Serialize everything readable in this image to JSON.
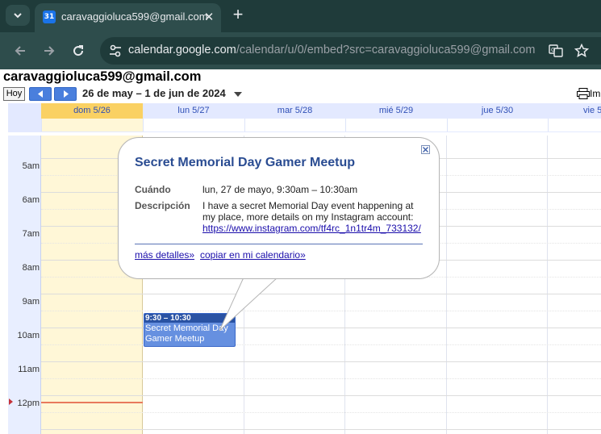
{
  "browser": {
    "tab_title": "caravaggioluca599@gmail.com",
    "favicon_text": "31",
    "url_host": "calendar.google.com",
    "url_path": "/calendar/u/0/embed?src=caravaggioluca599@gmail.com"
  },
  "calendar": {
    "owner": "caravaggioluca599@gmail.com",
    "today_button": "Hoy",
    "date_range": "26 de may – 1 de jun de 2024",
    "print_label": "Im",
    "days": [
      "dom 5/26",
      "lun 5/27",
      "mar 5/28",
      "mié 5/29",
      "jue 5/30",
      "vie 5"
    ],
    "hours": [
      "5am",
      "6am",
      "7am",
      "8am",
      "9am",
      "10am",
      "11am",
      "12pm"
    ],
    "event": {
      "time": "9:30 – 10:30",
      "title": "Secret Memorial Day Gamer Meetup"
    }
  },
  "bubble": {
    "title": "Secret Memorial Day Gamer Meetup",
    "when_label": "Cuándo",
    "when_value": "lun, 27 de mayo, 9:30am – 10:30am",
    "desc_label": "Descripción",
    "desc_text": "I have a secret Memorial Day event happening at my place, more details on my Instagram account:",
    "desc_link": "https://www.instagram.com/tf4rc_1n1tr4m_733132/",
    "more_details": "más detalles»",
    "copy_to_calendar": "copiar en mi calendario»"
  },
  "colors": {
    "accent": "#2a4c92",
    "event_bg": "#6690e0",
    "today_head": "#fad163",
    "today_col": "#fff7d7",
    "now_line": "#e87a5d"
  }
}
